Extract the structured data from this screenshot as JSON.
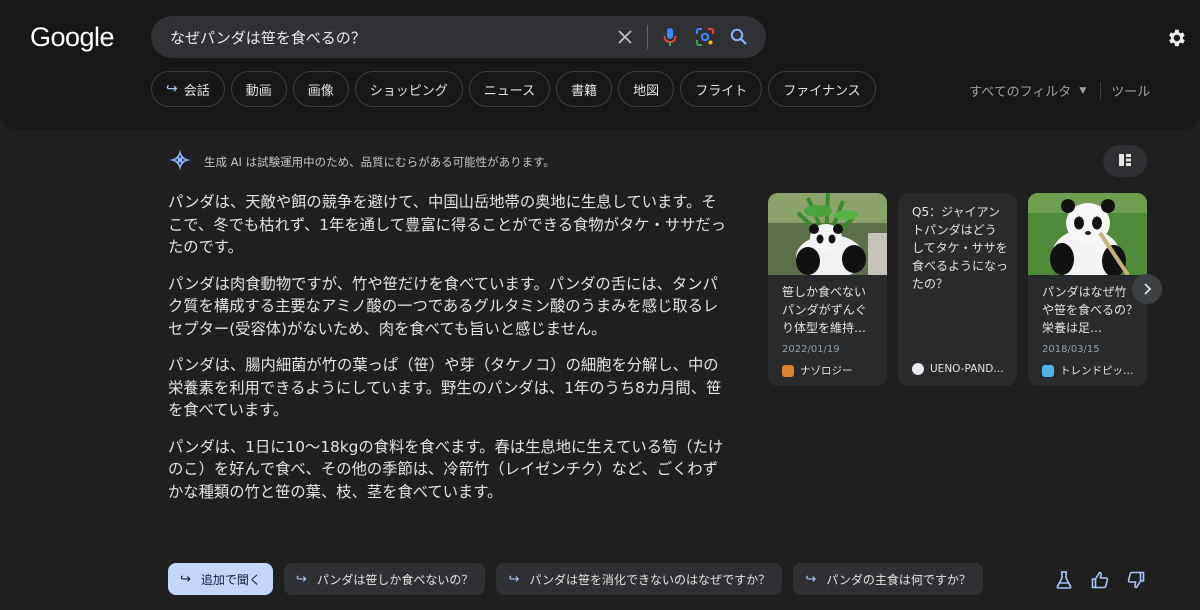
{
  "header": {
    "logo": "Google",
    "search": {
      "value": "なぜパンダは笹を食べるの？"
    }
  },
  "chips": [
    {
      "label": "会話",
      "has_arrow": true
    },
    {
      "label": "動画"
    },
    {
      "label": "画像"
    },
    {
      "label": "ショッピング"
    },
    {
      "label": "ニュース"
    },
    {
      "label": "書籍"
    },
    {
      "label": "地図"
    },
    {
      "label": "フライト"
    },
    {
      "label": "ファイナンス"
    }
  ],
  "filters": {
    "all_filters": "すべてのフィルタ",
    "tools": "ツール"
  },
  "ai": {
    "notice": "生成 AI は試験運用中のため、品質にむらがある可能性があります。",
    "paragraphs": [
      "パンダは、天敵や餌の競争を避けて、中国山岳地帯の奥地に生息しています。そこで、冬でも枯れず、1年を通して豊富に得ることができる食物がタケ・ササだったのです。",
      "パンダは肉食動物ですが、竹や笹だけを食べています。パンダの舌には、タンパク質を構成する主要なアミノ酸の一つであるグルタミン酸のうまみを感じ取るレセプター(受容体)がないため、肉を食べても旨いと感じません。",
      "パンダは、腸内細菌が竹の葉っぱ（笹）や芽（タケノコ）の細胞を分解し、中の栄養素を利用できるようにしています。野生のパンダは、1年のうち8カ月間、笹を食べています。",
      "パンダは、1日に10〜18kgの食料を食べます。春は生息地に生えている筍（たけのこ）を好んで食べ、その他の季節は、冷箭竹（レイゼンチク）など、ごくわずかな種類の竹と笹の葉、枝、茎を食べています。"
    ]
  },
  "cards": [
    {
      "title": "笹しか食べないパンダがずんぐり体型を維持…",
      "date": "2022/01/19",
      "source": "ナゾロジー",
      "favicon_color": "#d9822b",
      "image": "panda-eating-bamboo"
    },
    {
      "title": "Q5：ジャイアントパンダはどうしてタケ・ササを食べるようになったの？",
      "date": "",
      "source": "UENO-PAND…",
      "favicon_color": "#e8eaed",
      "image": "none"
    },
    {
      "title": "パンダはなぜ竹や笹を食べるの？栄養は足…",
      "date": "2018/03/15",
      "source": "トレンドピッ…",
      "favicon_color": "#4fb3e8",
      "image": "panda-on-grass"
    }
  ],
  "followups": [
    {
      "label": "追加で聞く",
      "primary": true
    },
    {
      "label": "パンダは笹しか食べないの？"
    },
    {
      "label": "パンダは笹を消化できないのはなぜですか？"
    },
    {
      "label": "パンダの主食は何ですか？"
    }
  ],
  "colors": {
    "accent": "#a8c7fa",
    "primary_chip": "#c2d7f9",
    "background": "#1f1f1f",
    "topbar": "#171717"
  },
  "icons": [
    "clear-icon",
    "mic-icon",
    "lens-icon",
    "search-icon",
    "settings-icon",
    "ai-sparkle-icon",
    "layout-icon",
    "chevron-right-icon",
    "lab-icon",
    "thumbs-up-icon",
    "thumbs-down-icon"
  ]
}
